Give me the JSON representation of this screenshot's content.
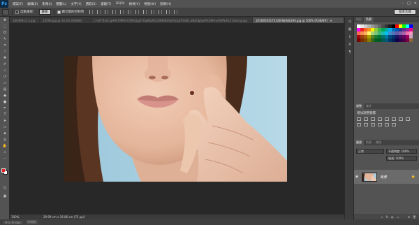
{
  "menu": {
    "logo": "Ps",
    "items": [
      "檔案(F)",
      "編輯(E)",
      "影像(I)",
      "圖層(L)",
      "文字(Y)",
      "選取(S)",
      "濾鏡(T)",
      "3D(D)",
      "檢視(V)",
      "視窗(W)",
      "說明(H)"
    ],
    "window_controls": [
      "–",
      "□",
      "✕"
    ]
  },
  "options": {
    "auto_select_label": "自動選取：",
    "auto_select_target": "群組",
    "transform_label": "顯示變形控制項",
    "workspace": "基本功能"
  },
  "tabs": [
    {
      "label": "18649813_n.jpg"
    },
    {
      "label": "10590.jpg @ 33.3% (RGB/8)"
    },
    {
      "label": "c7d2FTJuiS_gHPo70M9nYQMxQgj37OgMbWOzQNWBZ9pPxGgFKGOE_wBA0gfjwIXXU9Hnv9WW4I1k7zwXsg.jpg"
    },
    {
      "label": "20180104173128-8b0db19d.jpg @ 100% (RGB/8#)",
      "close": "✕"
    }
  ],
  "status": {
    "zoom": "100%",
    "doc_info": "29.99 cm x 16.86 cm (72 ppi)"
  },
  "bottom": [
    "Mini Bridge",
    "時間軸"
  ],
  "panels": {
    "swatch_tabs": [
      "色彩",
      "色票"
    ],
    "swatch_colors": [
      "#ffffff",
      "#e5e5e5",
      "#cccccc",
      "#b3b3b3",
      "#999999",
      "#808080",
      "#666666",
      "#4d4d4d",
      "#333333",
      "#1a1a1a",
      "#000000",
      "#ff0000",
      "#ffff00",
      "#00ff00",
      "#00ffff",
      "#0000ff",
      "#ff00ff",
      "#ed1c24",
      "#f26522",
      "#f7941d",
      "#fff200",
      "#8dc63f",
      "#39b54a",
      "#00a651",
      "#00a99d",
      "#00aeef",
      "#0072bc",
      "#0054a6",
      "#2e3192",
      "#662d91",
      "#92278f",
      "#ec008c",
      "#f26c4f",
      "#f68e56",
      "#fbaf5d",
      "#fff568",
      "#acd373",
      "#7cc576",
      "#3cb878",
      "#1abbb4",
      "#00bff3",
      "#448ccb",
      "#5674b9",
      "#605ca8",
      "#8560a8",
      "#a864a8",
      "#f06eaa",
      "#f49ac1",
      "#9e0b0f",
      "#a0410d",
      "#a3620a",
      "#aba000",
      "#598527",
      "#197b30",
      "#007236",
      "#00746b",
      "#0076a3",
      "#004a80",
      "#003471",
      "#1b1464",
      "#440e62",
      "#630460",
      "#9e005d",
      "#c9a3bf",
      "#790000",
      "#7b2e00",
      "#7d4900",
      "#827b00",
      "#406618",
      "#005e20",
      "#005826",
      "#005952",
      "#005b7f",
      "#003663",
      "#002157",
      "#0d004c",
      "#32004b",
      "#4b0049",
      "#7b0046",
      "#8c6239"
    ],
    "adj_tabs": [
      "調整",
      "樣式"
    ],
    "adj_title": "增加調整圖層",
    "layer_tabs": [
      "圖層",
      "色版",
      "路徑"
    ],
    "blend_mode": "正常",
    "opacity": "不透明度: 100%",
    "fill": "填滿: 100%",
    "layer_name": "背景",
    "layer_footer": [
      "fx",
      "◐",
      "▭",
      "🗀",
      "⊞",
      "🗑"
    ]
  }
}
